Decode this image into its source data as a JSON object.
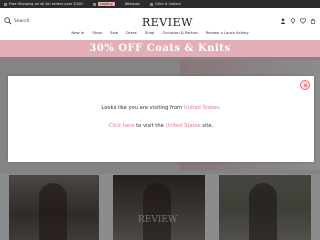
{
  "topbar": {
    "items": [
      "Free Shipping on all AU orders over $100",
      "Laybuy",
      "Afterpay",
      "Click & Collect"
    ]
  },
  "header": {
    "search_label": "Search",
    "logo": "REVIEW"
  },
  "nav": [
    "New In",
    "Shop",
    "Sale",
    "Dress",
    "Shop",
    "Occasion & Parties",
    "Review x Laura Ashley"
  ],
  "banner": {
    "text": "30% OFF Coats & Knits"
  },
  "modal": {
    "line1_prefix": "Looks like you are visiting from ",
    "line1_country": "United States",
    "line1_suffix": ".",
    "line2_link": "Click here",
    "line2_mid": " to visit the ",
    "line2_country": "United States",
    "line2_suffix": " site."
  },
  "tiles": {
    "watermark": "REVIEW"
  },
  "colors": {
    "accent": "#e07a86",
    "banner": "#e2aeb7",
    "topbar": "#2b2b2b"
  }
}
